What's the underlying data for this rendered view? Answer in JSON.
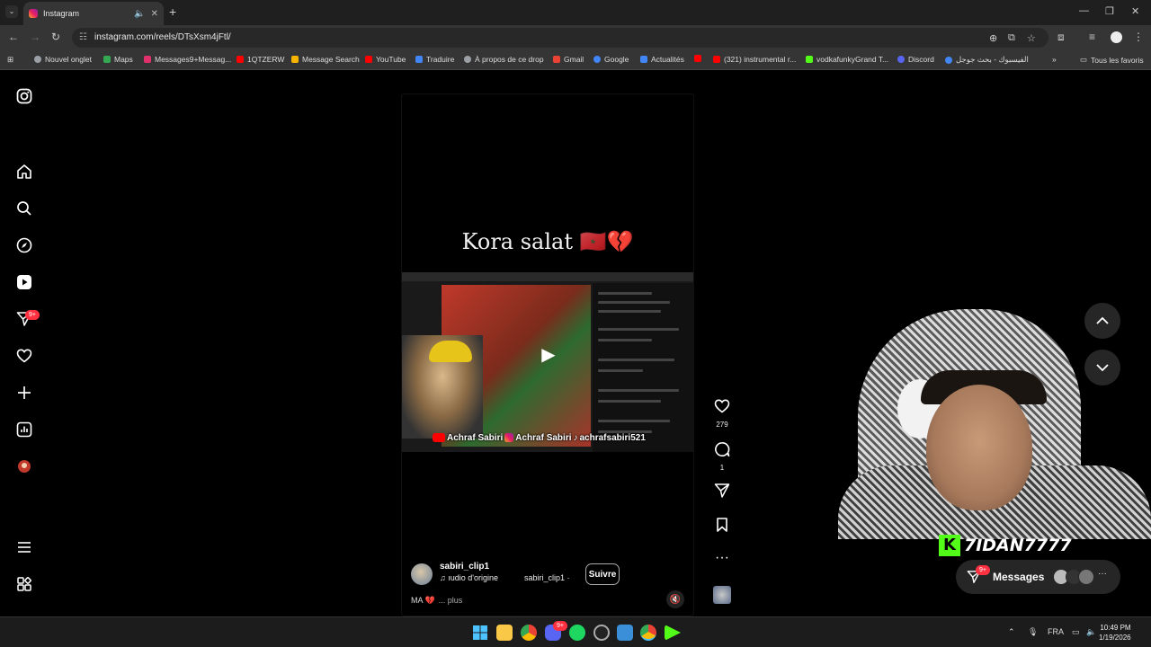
{
  "browser": {
    "tab_title": "Instagram",
    "url": "instagram.com/reels/DTsXsm4jFtl/",
    "bookmarks": [
      {
        "label": "Nouvel onglet",
        "color": "#9aa0a6"
      },
      {
        "label": "Maps",
        "color": "#34a853"
      },
      {
        "label": "Messages9+Messag...",
        "color": "#e1306c"
      },
      {
        "label": "1QTZERW",
        "color": "#ff0000"
      },
      {
        "label": "Message Search",
        "color": "#f4b400"
      },
      {
        "label": "YouTube",
        "color": "#ff0000"
      },
      {
        "label": "Traduire",
        "color": "#4285f4"
      },
      {
        "label": "À propos de ce drop",
        "color": "#9aa0a6"
      },
      {
        "label": "Gmail",
        "color": "#ea4335"
      },
      {
        "label": "Google",
        "color": "#4285f4"
      },
      {
        "label": "Actualités",
        "color": "#4285f4"
      },
      {
        "label": "",
        "color": "#ff0000"
      },
      {
        "label": "(321) instrumental r...",
        "color": "#ff0000"
      },
      {
        "label": "vodkafunkyGrand T...",
        "color": "#53fc18"
      },
      {
        "label": "Discord",
        "color": "#5865f2"
      },
      {
        "label": "الفيسبوك - بحث جوجل",
        "color": "#4285f4"
      }
    ],
    "all_bookmarks_label": "Tous les favoris"
  },
  "sidenav": {
    "notifications_badge": "9+"
  },
  "reel": {
    "caption": "Kora salat 🇲🇦💔",
    "overlay_socials": {
      "youtube": "Achraf Sabiri",
      "instagram": "Achraf Sabiri",
      "tiktok": "achrafsabiri521"
    },
    "username": "sabiri_clip1",
    "audio_label": "ıudio d'origine",
    "audio_owner": "sabiri_clip1 ·",
    "follow_label": "Suivre",
    "description": "MA 💔",
    "more_label": "... plus"
  },
  "actions": {
    "likes": "279",
    "comments": "1"
  },
  "webcam": {
    "channel_name": "7IDAN7777",
    "channel_logo_letter": "K"
  },
  "messages_pill": {
    "label": "Messages",
    "badge": "9+"
  },
  "taskbar": {
    "language": "FRA",
    "time": "10:49 PM",
    "date": "1/19/2026",
    "discord_badge": "9+"
  }
}
